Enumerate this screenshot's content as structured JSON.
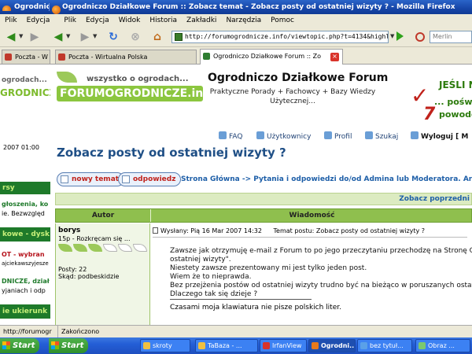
{
  "window": {
    "title_left": "Ogrodniczo",
    "title_right": "Ogrodniczo Działkowe Forum :: Zobacz temat - Zobacz posty od ostatniej wizyty ? - Mozilla Firefox"
  },
  "menu": [
    "Plik",
    "Edycja",
    "Widok",
    "Historia",
    "Zakładki",
    "Narzędzia",
    "Pomoc"
  ],
  "menu_left": [
    "Plik",
    "Edycja"
  ],
  "toolbar": {
    "url": "http://forumogrodnicze.info/viewtopic.php?t=4134&highlight=",
    "search_placeholder": "Merlin"
  },
  "tabs": [
    {
      "label": "Poczta - W"
    },
    {
      "label": "Poczta - Wirtualna Polska"
    },
    {
      "label": "Ogrodniczo Działkowe Forum :: Zo",
      "active": true
    }
  ],
  "sidebar": {
    "logo_small": "ogrodach...",
    "logo_big": "GRODNICZE.in",
    "date": "2007 01:00",
    "bar1": "rsy",
    "text1": "głoszenia, ko",
    "text2": "ie. Bezwzględ",
    "bar2": "kowe - dysk",
    "text3": "OT - wybran",
    "text4": "ajciekawszyjesze",
    "text5": "DNICZE, dział",
    "text6": "yjaniach i odp",
    "bar3": "ie ukierunk"
  },
  "header": {
    "logo_small": "wszystko o ogrodach...",
    "logo_big": "FORUMOGRODNICZE.info",
    "site_title": "Ogrodniczo Działkowe Forum",
    "site_subtitle": "Praktyczne Porady + Fachowcy + Bazy Wiedzy Użytecznej...",
    "ad_line1": "JEŚLI N",
    "ad_line2": "... poświę",
    "ad_line3": "powodó"
  },
  "nav": {
    "faq": "FAQ",
    "users": "Użytkownicy",
    "profile": "Profil",
    "search": "Szukaj",
    "logout": "Wyloguj [ M"
  },
  "topic": {
    "heading": "Zobacz posty od ostatniej wizyty ?",
    "new_topic": "nowy temat",
    "reply": "odpowiedz",
    "breadcrumb": "Strona Główna -> Pytania i odpowiedzi do/od Admina lub Moderatora. Archi",
    "prev_next": "Zobacz poprzedni"
  },
  "table": {
    "col_author": "Autor",
    "col_message": "Wiadomość"
  },
  "post": {
    "author": "borys",
    "rank": "15p - Rozkręcam się ...",
    "rank_leaves_on": 3,
    "rank_leaves_total": 6,
    "posts": "Posty: 22",
    "from": "Skąd: podbeskidzie",
    "posted": "Wysłany: Pią 16 Mar 2007 14:32",
    "subject": "Temat postu: Zobacz posty od ostatniej wizyty ?",
    "body": [
      "Zawsze jak otrzymuję e-mail z Forum to po jego przeczytaniu przechodzę na Stronę G",
      "ostatniej wizyty\".",
      "Niestety zawsze prezentowany mi jest tylko jeden post.",
      "Wiem że to nieprawda.",
      "Bez przejżenia postów od ostatniej wizyty trudno być na bieżąco w poruszanych ostat",
      "Dlaczego tak się dzieje ?"
    ],
    "signature": "Czasami moja klawiatura nie pisze polskich liter."
  },
  "status": {
    "left": "http://forumogr",
    "right": "Zakończono"
  },
  "taskbar": {
    "start_label": "Start",
    "items": [
      {
        "label": "Start"
      },
      {
        "label": "skroty"
      },
      {
        "label": "TaBaza - ..."
      },
      {
        "label": "IrfanView"
      },
      {
        "label": "Ogrodni..."
      },
      {
        "label": "bez tytuł..."
      },
      {
        "label": "Obraz ..."
      }
    ]
  },
  "colors": {
    "brand_green": "#8cc63f",
    "heading_blue": "#1f4f86",
    "table_header_green": "#8fbf4e"
  }
}
